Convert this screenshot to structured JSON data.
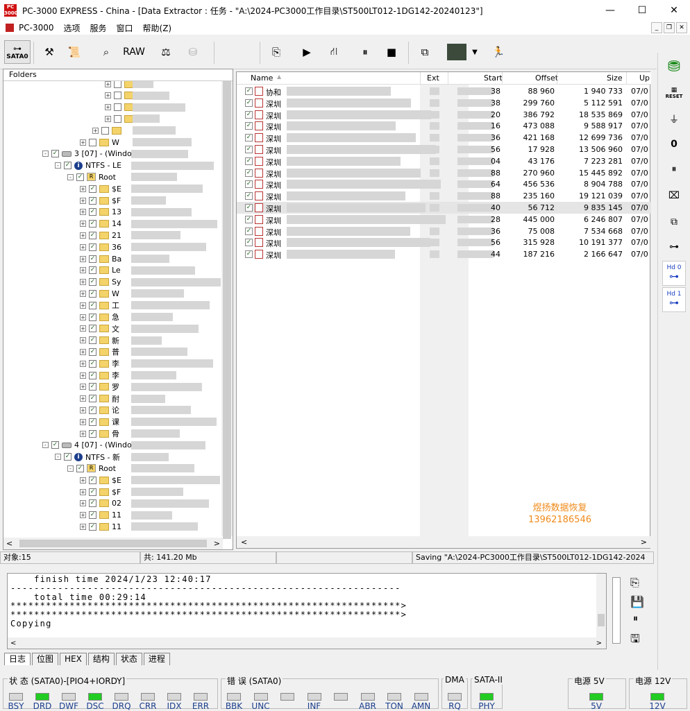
{
  "window": {
    "title": "PC-3000 EXPRESS - China - [Data Extractor : 任务 - \"A:\\2024-PC3000工作目录\\ST500LT012-1DG142-20240123\"]",
    "logo_text": "PC 3000",
    "minimize": "—",
    "maximize": "☐",
    "close": "✕"
  },
  "menu": {
    "items": [
      "PC-3000",
      "选项",
      "服务",
      "窗口",
      "帮助(Z)"
    ],
    "mdi_min": "_",
    "mdi_restore": "❐",
    "mdi_close": "✕"
  },
  "toolbar": {
    "sata_label": "SATA0",
    "raw_label": "RAW",
    "icons": [
      "tools-icon",
      "scroll-icon",
      "binoculars-icon",
      "raw-icon",
      "scale-icon",
      "disk-icon",
      "export-icon",
      "play-icon",
      "flow-icon",
      "pause-icon",
      "stop-icon",
      "copy-icon",
      "image-icon",
      "run-icon"
    ]
  },
  "sidebar": {
    "reset_label": "RESET",
    "hd0": "Hd 0",
    "hd1": "Hd 1"
  },
  "left_panel": {
    "header": "Folders",
    "tree": [
      {
        "indent": 152,
        "exp": "+",
        "chk": "",
        "icon": "folder",
        "label": ""
      },
      {
        "indent": 152,
        "exp": "+",
        "chk": "",
        "icon": "folder",
        "label": ""
      },
      {
        "indent": 152,
        "exp": "+",
        "chk": "",
        "icon": "folder",
        "label": ""
      },
      {
        "indent": 152,
        "exp": "+",
        "chk": "",
        "icon": "folder",
        "label": ""
      },
      {
        "indent": 134,
        "exp": "+",
        "chk": "",
        "icon": "folder",
        "label": ""
      },
      {
        "indent": 116,
        "exp": "+",
        "chk": "",
        "icon": "folder",
        "label": "W"
      },
      {
        "indent": 62,
        "exp": "-",
        "chk": "✓",
        "icon": "disk",
        "label": "3 [07] - (Windo"
      },
      {
        "indent": 80,
        "exp": "-",
        "chk": "✓",
        "icon": "info",
        "label": "NTFS - LE"
      },
      {
        "indent": 98,
        "exp": "-",
        "chk": "✓",
        "icon": "root",
        "label": "Root"
      },
      {
        "indent": 116,
        "exp": "+",
        "chk": "✓",
        "icon": "folder",
        "label": "$E"
      },
      {
        "indent": 116,
        "exp": "+",
        "chk": "✓",
        "icon": "folder",
        "label": "$F"
      },
      {
        "indent": 116,
        "exp": "+",
        "chk": "✓",
        "icon": "folder",
        "label": "13"
      },
      {
        "indent": 116,
        "exp": "+",
        "chk": "✓",
        "icon": "folder",
        "label": "14"
      },
      {
        "indent": 116,
        "exp": "+",
        "chk": "✓",
        "icon": "folder",
        "label": "21"
      },
      {
        "indent": 116,
        "exp": "+",
        "chk": "✓",
        "icon": "folder",
        "label": "36"
      },
      {
        "indent": 116,
        "exp": "+",
        "chk": "✓",
        "icon": "folder",
        "label": "Ba"
      },
      {
        "indent": 116,
        "exp": "+",
        "chk": "✓",
        "icon": "folder",
        "label": "Le"
      },
      {
        "indent": 116,
        "exp": "+",
        "chk": "✓",
        "icon": "folder",
        "label": "Sy"
      },
      {
        "indent": 116,
        "exp": "+",
        "chk": "✓",
        "icon": "folder",
        "label": "W"
      },
      {
        "indent": 116,
        "exp": "+",
        "chk": "✓",
        "icon": "folder",
        "label": "工"
      },
      {
        "indent": 116,
        "exp": "+",
        "chk": "✓",
        "icon": "folder",
        "label": "急"
      },
      {
        "indent": 116,
        "exp": "+",
        "chk": "✓",
        "icon": "folder",
        "label": "文"
      },
      {
        "indent": 116,
        "exp": "+",
        "chk": "✓",
        "icon": "folder",
        "label": "新"
      },
      {
        "indent": 116,
        "exp": "+",
        "chk": "✓",
        "icon": "folder",
        "label": "普"
      },
      {
        "indent": 116,
        "exp": "+",
        "chk": "✓",
        "icon": "folder",
        "label": "李"
      },
      {
        "indent": 116,
        "exp": "+",
        "chk": "✓",
        "icon": "folder",
        "label": "李"
      },
      {
        "indent": 116,
        "exp": "+",
        "chk": "✓",
        "icon": "folder",
        "label": "罗"
      },
      {
        "indent": 116,
        "exp": "+",
        "chk": "✓",
        "icon": "folder",
        "label": "耐"
      },
      {
        "indent": 116,
        "exp": "+",
        "chk": "✓",
        "icon": "folder",
        "label": "论"
      },
      {
        "indent": 116,
        "exp": "+",
        "chk": "✓",
        "icon": "folder",
        "label": "课"
      },
      {
        "indent": 116,
        "exp": "+",
        "chk": "✓",
        "icon": "folder",
        "label": "骨"
      },
      {
        "indent": 62,
        "exp": "-",
        "chk": "✓",
        "icon": "disk",
        "label": "4 [07] - (Windo"
      },
      {
        "indent": 80,
        "exp": "-",
        "chk": "✓",
        "icon": "info",
        "label": "NTFS - 新"
      },
      {
        "indent": 98,
        "exp": "-",
        "chk": "✓",
        "icon": "root",
        "label": "Root"
      },
      {
        "indent": 116,
        "exp": "+",
        "chk": "✓",
        "icon": "folder",
        "label": "$E"
      },
      {
        "indent": 116,
        "exp": "+",
        "chk": "✓",
        "icon": "folder",
        "label": "$F"
      },
      {
        "indent": 116,
        "exp": "+",
        "chk": "✓",
        "icon": "folder",
        "label": "02"
      },
      {
        "indent": 116,
        "exp": "+",
        "chk": "✓",
        "icon": "folder",
        "label": "11"
      },
      {
        "indent": 116,
        "exp": "+",
        "chk": "✓",
        "icon": "folder",
        "label": "11"
      }
    ],
    "scroll_left": "<",
    "scroll_right": ">"
  },
  "file_list": {
    "columns": [
      "Name",
      "Ext",
      "Start",
      "Offset",
      "Size",
      "Up"
    ],
    "rows": [
      {
        "name": "协和",
        "start": "38",
        "offset": "88 960",
        "size": "1 940 733",
        "up": "07/0"
      },
      {
        "name": "深圳",
        "start": "38",
        "offset": "299 760",
        "size": "5 112 591",
        "up": "07/0"
      },
      {
        "name": "深圳",
        "start": "20",
        "offset": "386 792",
        "size": "18 535 869",
        "up": "07/0"
      },
      {
        "name": "深圳",
        "start": "16",
        "offset": "473 088",
        "size": "9 588 917",
        "up": "07/0"
      },
      {
        "name": "深圳",
        "start": "36",
        "offset": "421 168",
        "size": "12 699 736",
        "up": "07/0"
      },
      {
        "name": "深圳",
        "start": "56",
        "offset": "17 928",
        "size": "13 506 960",
        "up": "07/0"
      },
      {
        "name": "深圳",
        "start": "04",
        "offset": "43 176",
        "size": "7 223 281",
        "up": "07/0"
      },
      {
        "name": "深圳",
        "start": "88",
        "offset": "270 960",
        "size": "15 445 892",
        "up": "07/0"
      },
      {
        "name": "深圳",
        "start": "64",
        "offset": "456 536",
        "size": "8 904 788",
        "up": "07/0"
      },
      {
        "name": "深圳",
        "start": "88",
        "offset": "235 160",
        "size": "19 121 039",
        "up": "07/0"
      },
      {
        "name": "深圳",
        "start": "40",
        "offset": "56 712",
        "size": "9 835 145",
        "up": "07/0"
      },
      {
        "name": "深圳",
        "start": "28",
        "offset": "445 000",
        "size": "6 246 807",
        "up": "07/0"
      },
      {
        "name": "深圳",
        "start": "36",
        "offset": "75 008",
        "size": "7 534 668",
        "up": "07/0"
      },
      {
        "name": "深圳",
        "start": "56",
        "offset": "315 928",
        "size": "10 191 377",
        "up": "07/0"
      },
      {
        "name": "深圳",
        "start": "44",
        "offset": "187 216",
        "size": "2 166 647",
        "up": "07/0"
      }
    ],
    "selected_index": 10,
    "watermark_line1": "煜扬数据恢复",
    "watermark_line2": "13962186546",
    "scroll_left": "<",
    "scroll_right": ">"
  },
  "status": {
    "objects": "对象:15",
    "total": "共: 141.20 Mb",
    "saving": "Saving  \"A:\\2024-PC3000工作目录\\ST500LT012-1DG142-2024"
  },
  "log": {
    "text": "    finish time 2024/1/23 12:40:17\n------------------------------------------------------------------\n    total time 00:29:14\n******************************************************************>\n******************************************************************>\nCopying",
    "scroll_left": "<",
    "scroll_right": ">"
  },
  "tabs": [
    "日志",
    "位图",
    "HEX",
    "结构",
    "状态",
    "进程"
  ],
  "leds": {
    "status_title": "状 态 (SATA0)-[PIO4+IORDY]",
    "status": [
      {
        "label": "BSY",
        "on": false
      },
      {
        "label": "DRD",
        "on": true
      },
      {
        "label": "DWF",
        "on": false
      },
      {
        "label": "DSC",
        "on": true
      },
      {
        "label": "DRQ",
        "on": false
      },
      {
        "label": "CRR",
        "on": false
      },
      {
        "label": "IDX",
        "on": false
      },
      {
        "label": "ERR",
        "on": false
      }
    ],
    "error_title": "错 误 (SATA0)",
    "errors": [
      {
        "label": "BBK",
        "on": false
      },
      {
        "label": "UNC",
        "on": false
      },
      {
        "label": "",
        "on": false
      },
      {
        "label": "INF",
        "on": false
      },
      {
        "label": "",
        "on": false
      },
      {
        "label": "ABR",
        "on": false
      },
      {
        "label": "TON",
        "on": false
      },
      {
        "label": "AMN",
        "on": false
      }
    ],
    "dma_title": "DMA",
    "dma": {
      "label": "RQ",
      "on": false
    },
    "sata_title": "SATA-II",
    "sata": {
      "label": "PHY",
      "on": true
    },
    "p5_title": "电源 5V",
    "p5": {
      "label": "5V",
      "on": true
    },
    "p12_title": "电源 12V",
    "p12": {
      "label": "12V",
      "on": true
    },
    "on_color": "#22cc22"
  }
}
